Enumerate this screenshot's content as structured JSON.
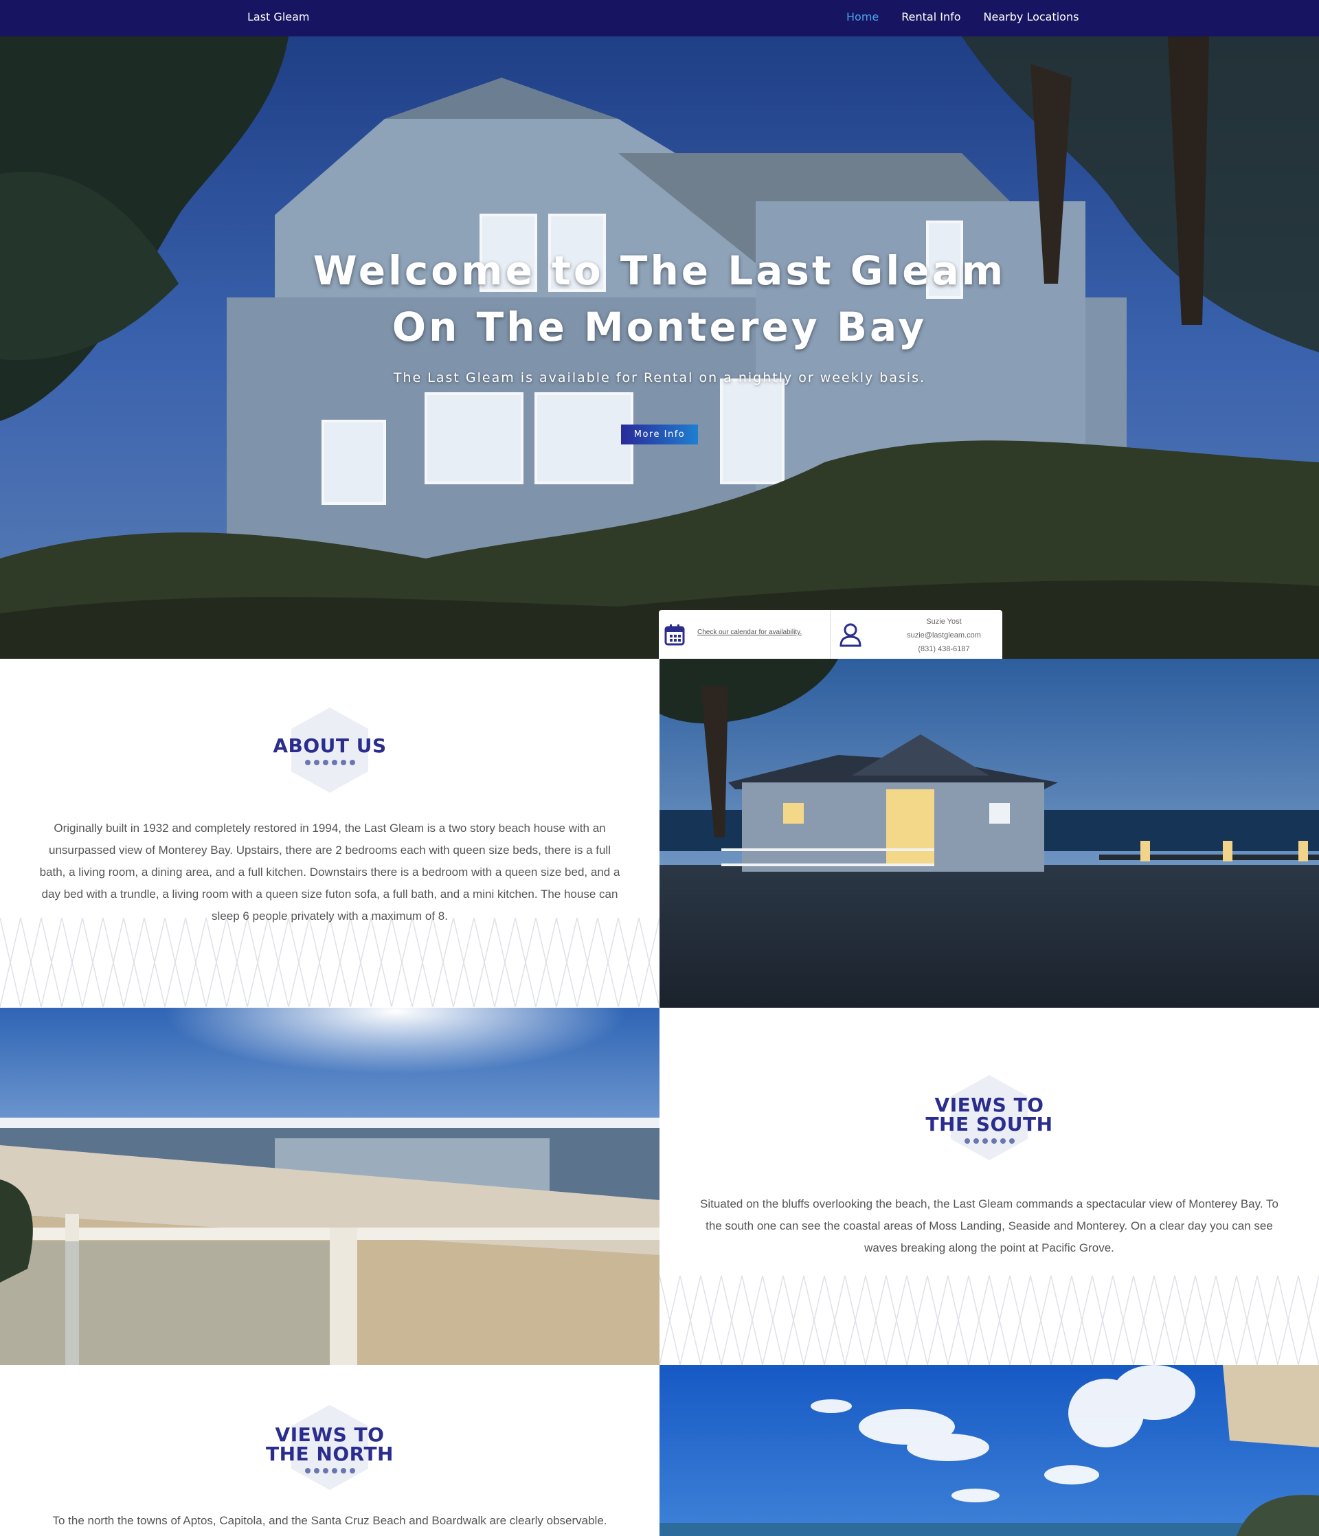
{
  "nav": {
    "brand": "Last Gleam",
    "links": [
      {
        "label": "Home",
        "active": true
      },
      {
        "label": "Rental Info",
        "active": false
      },
      {
        "label": "Nearby Locations",
        "active": false
      }
    ]
  },
  "hero": {
    "title_line1": "Welcome to The Last Gleam",
    "title_line2": "On The Monterey Bay",
    "subtitle": "The Last Gleam is available for Rental on a nightly or weekly basis.",
    "button_label": "More Info"
  },
  "info_card": {
    "calendar_link": "Check our calendar for availability.",
    "contact_name": "Suzie Yost",
    "contact_email": "suzie@lastgleam.com",
    "contact_phone": "(831) 438-6187"
  },
  "about": {
    "heading": "ABOUT US",
    "body": "Originally built in 1932 and completely restored in 1994, the Last Gleam is a two story beach house with an unsurpassed view of Monterey Bay.  Upstairs, there are 2 bedrooms  each with queen size beds, there is a full bath, a living room, a dining area, and a full kitchen. Downstairs there is a bedroom with a queen size bed, and a day bed with a trundle, a living room with a queen size futon sofa, a full bath, and a mini kitchen. The house can sleep 6 people privately with a maximum of 8."
  },
  "south": {
    "heading_line1": "VIEWS TO",
    "heading_line2": "THE SOUTH",
    "body": "Situated on the bluffs overlooking the beach, the Last Gleam commands a spectacular view of Monterey Bay.  To the south one can see the coastal areas of Moss Landing, Seaside and Monterey.  On a clear day you can see waves breaking along the point at Pacific Grove."
  },
  "north": {
    "heading_line1": "VIEWS TO",
    "heading_line2": "THE NORTH",
    "body": "To the north the towns of Aptos, Capitola, and the Santa Cruz Beach and Boardwalk are clearly observable."
  },
  "colors": {
    "nav_bg": "#171461",
    "nav_active": "#4aa3e8",
    "heading": "#2b2d8e",
    "button_start": "#2a2a9a",
    "button_end": "#1e7fd0"
  },
  "icons": [
    "calendar-icon",
    "user-icon"
  ]
}
